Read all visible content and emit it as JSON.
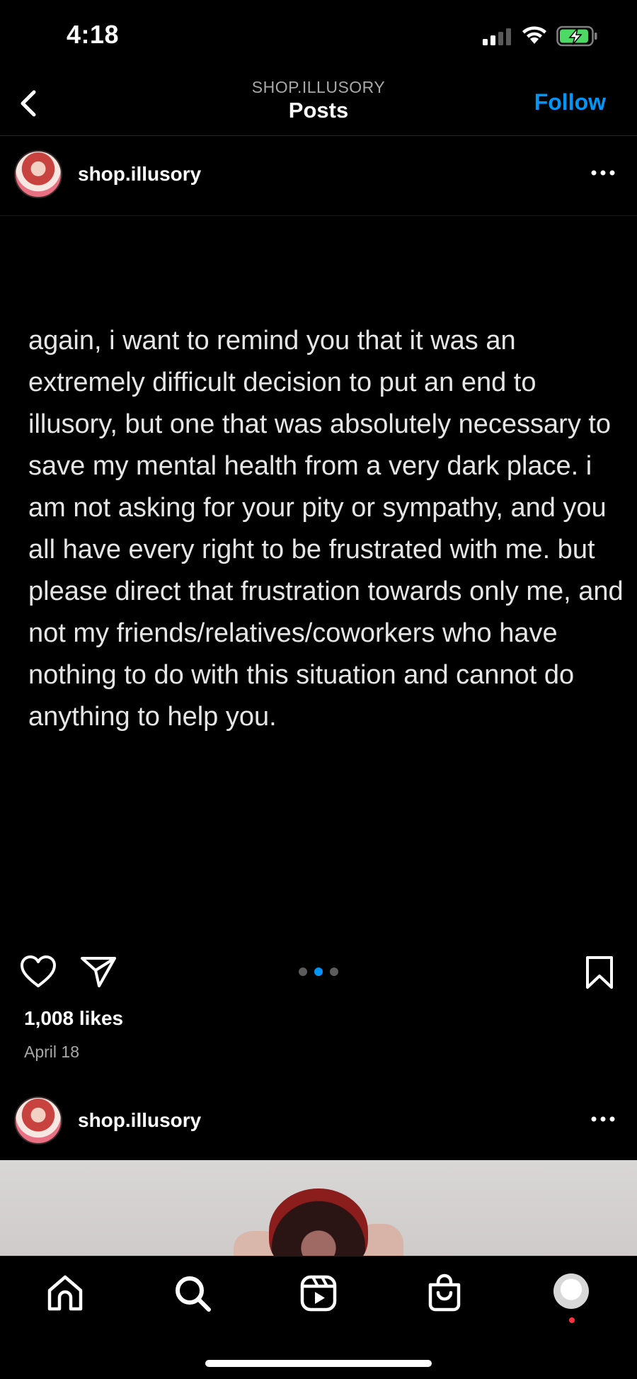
{
  "status_bar": {
    "time": "4:18"
  },
  "header": {
    "account_label": "SHOP.ILLUSORY",
    "title": "Posts",
    "follow_label": "Follow"
  },
  "post": {
    "username": "shop.illusory",
    "text": "again, i want to remind you that it was an extremely difficult decision to put an end to illusory, but one that was absolutely necessary to save my mental health from a very dark place. i am not asking for your pity or sympathy, and you all have every right to be frustrated with me. but please direct that frustration towards only me, and not my friends/relatives/coworkers who have nothing to do with this situation and cannot do anything to help you.",
    "likes": "1,008 likes",
    "date": "April 18",
    "carousel": {
      "count": 3,
      "active_index": 1
    }
  },
  "next_post": {
    "username": "shop.illusory"
  },
  "colors": {
    "background": "#000000",
    "accent": "#0095f6",
    "secondary_text": "#a8a8a8",
    "notification": "#ff3040"
  },
  "tab_bar": {
    "items": [
      "home-icon",
      "search-icon",
      "reels-icon",
      "shop-icon",
      "profile-avatar"
    ]
  }
}
